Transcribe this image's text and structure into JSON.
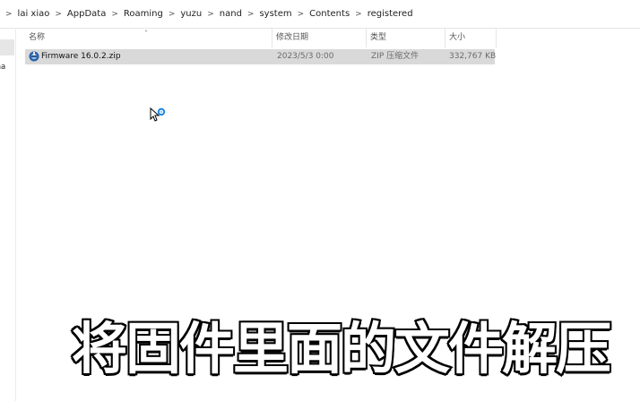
{
  "breadcrumb": {
    "items": [
      "lai xiao",
      "AppData",
      "Roaming",
      "yuzu",
      "nand",
      "system",
      "Contents",
      "registered"
    ],
    "separator": ">"
  },
  "nav": {
    "partial_label": "sona"
  },
  "columns": {
    "name": "名称",
    "date": "修改日期",
    "type": "类型",
    "size": "大小"
  },
  "files": [
    {
      "name": "Firmware 16.0.2.zip",
      "date": "2023/5/3 0:00",
      "type": "ZIP 压缩文件",
      "size": "332,767 KB",
      "icon": "zip-archive-icon"
    }
  ],
  "subtitle": "将固件里面的文件解压",
  "colors": {
    "selected_row": "#d9d9d9",
    "subtitle_fill": "#ffffff",
    "subtitle_stroke": "#000000"
  }
}
